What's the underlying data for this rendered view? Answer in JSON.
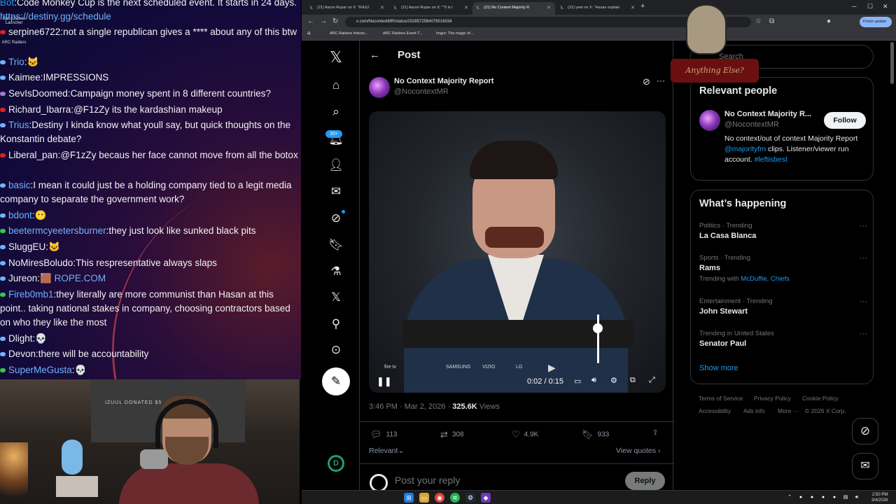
{
  "chat": {
    "lines": [
      {
        "user": "Bot",
        "text": "Code Monkey Cup is the next scheduled event. It starts in 24 days.",
        "extra": "https://destiny.gg/schedule",
        "color": "#1d9bf0"
      },
      {
        "user": "serpine6722",
        "text": "not a single republican gives a **** about any of this btw",
        "color": "#f2f2f2"
      },
      {
        "user": "Trio",
        "text": "",
        "color": "#6fb3ff"
      },
      {
        "user": "Kaimee",
        "text": "IMPRESSIONS",
        "color": "#f2f2f2"
      },
      {
        "user": "SevIsDoomed",
        "text": "Campaign money spent in 8 different countries?",
        "color": "#f2f2f2"
      },
      {
        "user": "Richard_Ibarra",
        "text": "@F1zZy its the kardashian makeup",
        "color": "#f2f2f2"
      },
      {
        "user": "Trius",
        "text": "Destiny I kinda know what youll say, but quick thoughts on the Konstantin debate?",
        "color": "#6fb3ff"
      },
      {
        "user": "Liberal_pan",
        "text": "@F1zZy becaus her face cannot move from all the botox",
        "color": "#f2f2f2"
      },
      {
        "user": "basic",
        "text": "I mean it could just be a holding company tied to a legit media company to separate the government work?",
        "color": "#6fb3ff"
      },
      {
        "user": "bdont",
        "text": "",
        "color": "#6fb3ff"
      },
      {
        "user": "beetermcyeetersburner",
        "text": "they just look like sunked black pits",
        "color": "#6fb3ff"
      },
      {
        "user": "SluggEU",
        "text": "",
        "color": "#f2f2f2"
      },
      {
        "user": "NoMiresBoludo",
        "text": "This respresentative always slaps",
        "color": "#f2f2f2"
      },
      {
        "user": "Jureon",
        "text": "ROPE.COM",
        "color": "#f2f2f2"
      },
      {
        "user": "Fireb0mb1",
        "text": "they literally are more communist than Hasan at this point.. taking national stakes in company, choosing contractors based on who they like the most",
        "color": "#6fb3ff"
      },
      {
        "user": "Dlight",
        "text": "",
        "color": "#f2f2f2"
      },
      {
        "user": "Devon",
        "text": "there will be accountability",
        "color": "#f2f2f2"
      },
      {
        "user": "SuperMeGusta",
        "text": "",
        "color": "#6fb3ff"
      }
    ],
    "desktop_icons": [
      "Epic Games Launcher",
      "ARC Raiders"
    ]
  },
  "webcam": {
    "plaque": "IZUUL DONATED $5"
  },
  "browser": {
    "tabs": [
      {
        "title": "(21) Aaron Rupar on X: \"RAJU",
        "active": false
      },
      {
        "title": "(21) Aaron Rupar on X: \"\"It is t",
        "active": false
      },
      {
        "title": "(21) No Context Majority R",
        "active": true
      },
      {
        "title": "(21) yeet on X: \"Hasan explain",
        "active": false
      }
    ],
    "url": "x.com/NocontextMR/status/2028572564076016034",
    "finish_update": "Finish update",
    "bookmarks": [
      "ARC Raiders Interac...",
      "ARC Raiders Event T...",
      "Imgur: The magic of..."
    ]
  },
  "x": {
    "nav_badge": "20+",
    "post_header": "Post",
    "author": "No Context Majority Report",
    "handle": "@NocontextMR",
    "video": {
      "time": "0:02 / 0:15",
      "logos": [
        "fire tv",
        "",
        "SAMSUNG",
        "VIZIO",
        "LG"
      ],
      "volume": 0.72
    },
    "meta": {
      "time": "3:46 PM · Mar 2, 2026 · ",
      "views": "325.6K",
      "views_label": " Views"
    },
    "actions": {
      "replies": "113",
      "reposts": "308",
      "likes": "4.9K",
      "bookmarks": "933"
    },
    "relevant_sort": "Relevant",
    "view_quotes": "View quotes",
    "reply_placeholder": "Post your reply",
    "reply_button": "Reply"
  },
  "sidebar": {
    "search_placeholder": "Search",
    "relevant_people": {
      "title": "Relevant people",
      "name": "No Context Majority R...",
      "handle": "@NocontextMR",
      "follow": "Follow",
      "bio_1": "No context/out of context Majority Report ",
      "bio_link1": "@majorityfm",
      "bio_2": " clips. Listener/viewer run account. ",
      "bio_link2": "#leftisbest"
    },
    "whats_happening": {
      "title": "What’s happening",
      "trends": [
        {
          "category": "Politics · Trending",
          "name": "La Casa Blanca",
          "sub": "",
          "sub_links": ""
        },
        {
          "category": "Sports · Trending",
          "name": "Rams",
          "sub": "Trending with ",
          "sub_links": "McDuffie, Chiefs"
        },
        {
          "category": "Entertainment · Trending",
          "name": "John Stewart",
          "sub": "",
          "sub_links": ""
        },
        {
          "category": "Trending in United States",
          "name": "Senator Paul",
          "sub": "",
          "sub_links": ""
        }
      ],
      "show_more": "Show more"
    },
    "footer": [
      "Terms of Service",
      "Privacy Policy",
      "Cookie Policy",
      "Accessibility",
      "Ads info",
      "More ···",
      "© 2026 X Corp."
    ]
  },
  "overlay": {
    "plate": "Anything Else?"
  },
  "taskbar": {
    "time": "2:50 PM",
    "date": "3/4/2026"
  }
}
